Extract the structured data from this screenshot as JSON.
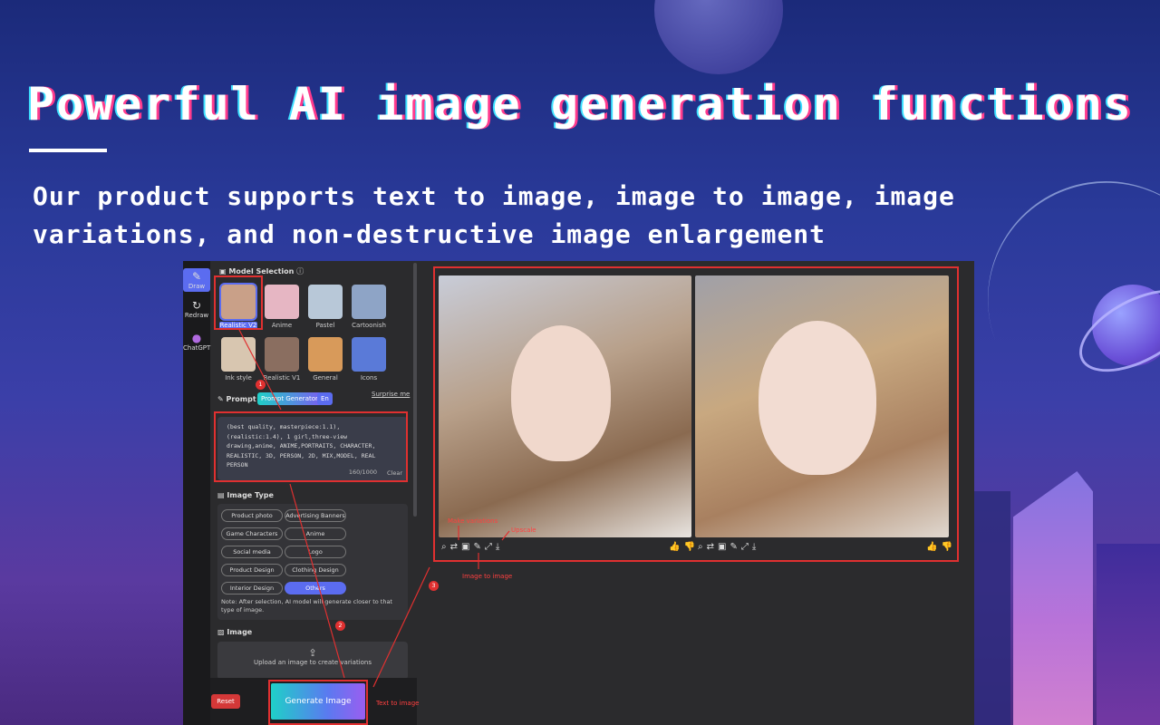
{
  "hero": {
    "title": "Powerful AI image generation functions",
    "subtitle": "Our product supports text to image, image to image, image variations, and non-destructive image enlargement"
  },
  "rail": {
    "items": [
      {
        "label": "Draw",
        "icon": "palette-icon"
      },
      {
        "label": "Redraw",
        "icon": "refresh-icon"
      },
      {
        "label": "ChatGPT",
        "icon": "chat-icon"
      }
    ]
  },
  "model_selection": {
    "title": "Model Selection",
    "models": [
      {
        "label": "Realistic V2",
        "color": "#c9a088"
      },
      {
        "label": "Anime",
        "color": "#e6b6c3"
      },
      {
        "label": "Pastel",
        "color": "#b8c8d8"
      },
      {
        "label": "Cartoonish",
        "color": "#8ea4c6"
      },
      {
        "label": "Ink style",
        "color": "#d8c6b0"
      },
      {
        "label": "Realistic V1",
        "color": "#8a6e60"
      },
      {
        "label": "General",
        "color": "#d89a5a"
      },
      {
        "label": "Icons",
        "color": "#5a7ad8"
      }
    ]
  },
  "prompt": {
    "title": "Prompt",
    "generator_label": "Prompt Generator",
    "lang_label": "En",
    "surprise_label": "Surprise me",
    "text": "(best quality, masterpiece:1.1), (realistic:1.4), 1 girl,three-view drawing,anime, ANIME,PORTRAITS, CHARACTER, REALISTIC, 3D, PERSON, 2D, MIX,MODEL, REAL PERSON",
    "counter": "160/1000",
    "clear_label": "Clear"
  },
  "image_type": {
    "title": "Image Type",
    "chips": [
      {
        "label": "Product photo",
        "active": false
      },
      {
        "label": "Advertising Banners",
        "active": false
      },
      {
        "label": "Game Characters",
        "active": false
      },
      {
        "label": "Anime",
        "active": false
      },
      {
        "label": "Social media",
        "active": false
      },
      {
        "label": "Logo",
        "active": false
      },
      {
        "label": "Product Design",
        "active": false
      },
      {
        "label": "Clothing Design",
        "active": false
      },
      {
        "label": "Interior Design",
        "active": false
      },
      {
        "label": "Others",
        "active": true
      }
    ],
    "note": "Note: After selection, AI model will generate closer to that type of image."
  },
  "image": {
    "title": "Image",
    "upload_label": "Upload an image to create variations"
  },
  "footer": {
    "reset_label": "Reset",
    "generate_label": "Generate Image"
  },
  "annotations": {
    "make_variations": "Make variations",
    "upscale": "Upscale",
    "image_to_image": "Image to image",
    "text_to_image": "Text to image",
    "badge_1": "1",
    "badge_2": "2",
    "badge_3": "3"
  },
  "colors": {
    "accent": "#5b6cf0",
    "annotation_red": "#e03030"
  }
}
